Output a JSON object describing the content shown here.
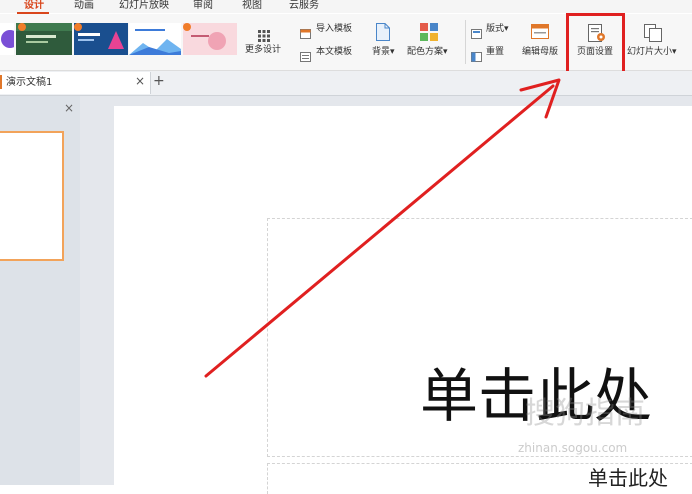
{
  "menu": {
    "tabs": [
      {
        "label": "设计",
        "active": true
      },
      {
        "label": "动画"
      },
      {
        "label": "幻灯片放映"
      },
      {
        "label": "审阅"
      },
      {
        "label": "视图"
      },
      {
        "label": "云服务"
      }
    ]
  },
  "ribbon": {
    "more_design_label": "更多设计",
    "import_template_label": "导入模板",
    "this_template_label": "本文模板",
    "background_label": "背景",
    "color_scheme_label": "配色方案",
    "layout_label": "版式",
    "reset_label": "重置",
    "edit_master_label": "编辑母版",
    "page_setup_label": "页面设置",
    "slide_size_label": "幻灯片大小",
    "dropdown_glyph": "▾"
  },
  "document_tab": {
    "title": "演示文稿1",
    "close_glyph": "×",
    "add_glyph": "+"
  },
  "panel": {
    "close_glyph": "×"
  },
  "slide": {
    "title_placeholder": "单击此处",
    "subtitle_placeholder": "单击此处"
  },
  "watermark": {
    "text": "搜狗指南",
    "url": "zhinan.sogou.com"
  },
  "colors": {
    "accent": "#d9461c",
    "highlight_box": "#e02020",
    "annotation_arrow": "#e02020"
  },
  "icons": {
    "design_thumbs": [
      "template-thumb-purple",
      "template-thumb-green",
      "template-thumb-blue",
      "template-thumb-gradient",
      "template-thumb-pink"
    ],
    "grid": "grid-icon",
    "page_setup": "page-setup-icon"
  }
}
